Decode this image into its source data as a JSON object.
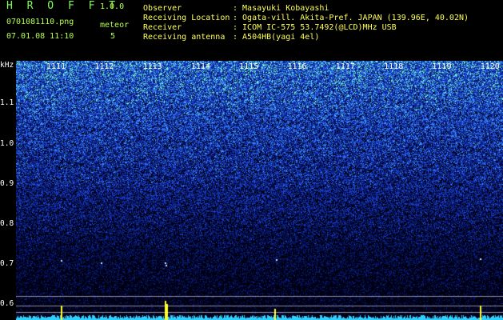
{
  "header": {
    "app_name": "H R O F F T",
    "version": "1.0.0",
    "filename": "0701081110.png",
    "timestamp": "07.01.08 11:10",
    "meteor_label": "meteor",
    "meteor_count": "5"
  },
  "info": {
    "observer_label": "Observer",
    "observer_value": ": Masayuki Kobayashi",
    "location_label": "Receiving Location",
    "location_value": ": Ogata-vill. Akita-Pref. JAPAN (139.96E, 40.02N)",
    "receiver_label": "Receiver",
    "receiver_value": ": ICOM IC-575 53.7492(@LCD)MHz USB",
    "antenna_label": "Receiving antenna",
    "antenna_value": ": A504HB(yagi 4el)"
  },
  "axis": {
    "unit": "kHz",
    "ticks": [
      "1.1",
      "1.0",
      "0.9",
      "0.8",
      "0.7",
      "0.6"
    ]
  },
  "minute_markers": [
    "1111",
    "1112",
    "1113",
    "1114",
    "1115",
    "1116",
    "1117",
    "1118",
    "1119",
    "1120"
  ],
  "colors": {
    "background": "#000000",
    "spectrum_dense": "#2a4dd8",
    "spectrum_sparse": "#0a1650",
    "highlight": "#7fffc0",
    "baseline": "#2fd0ff",
    "spike": "#ffff30"
  }
}
